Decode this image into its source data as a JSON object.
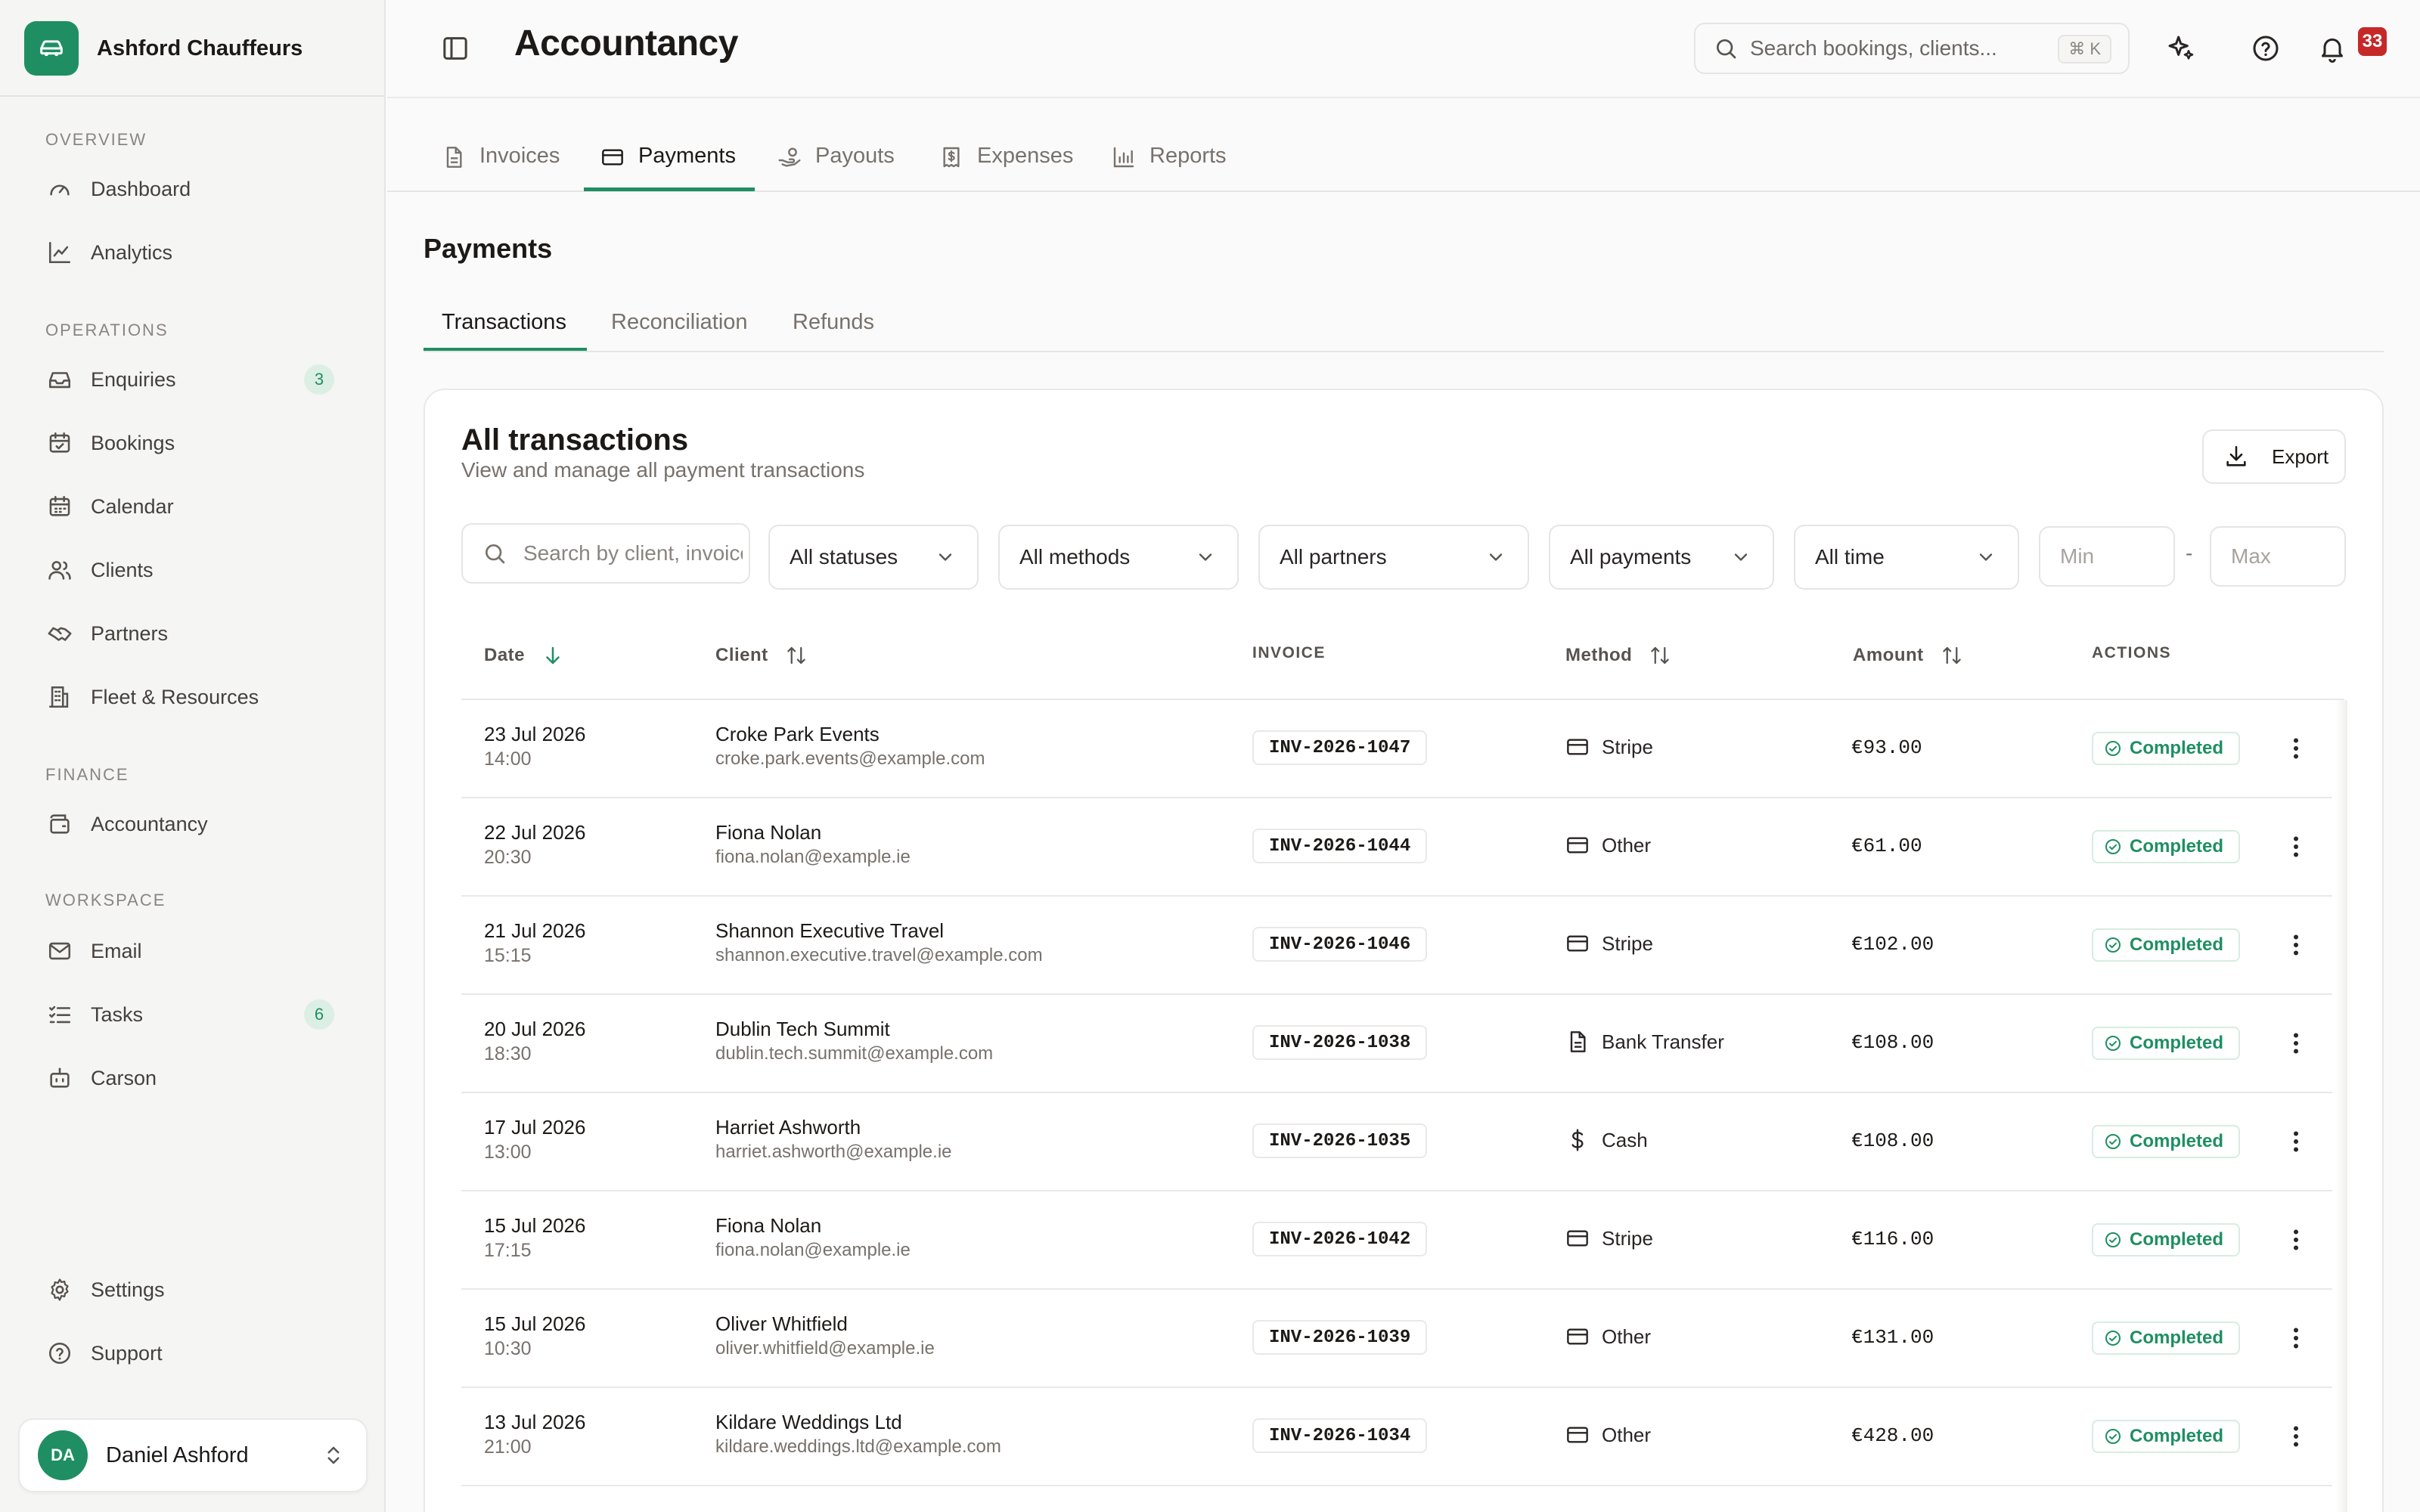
{
  "app": {
    "name": "Ashford Chauffeurs"
  },
  "sidebar": {
    "sections": [
      {
        "title": "OVERVIEW"
      },
      {
        "title": "OPERATIONS"
      },
      {
        "title": "FINANCE"
      },
      {
        "title": "WORKSPACE"
      }
    ],
    "items": [
      {
        "label": "Dashboard",
        "icon": "gauge-icon"
      },
      {
        "label": "Analytics",
        "icon": "line-chart-icon"
      },
      {
        "label": "Enquiries",
        "icon": "inbox-icon",
        "badge": "3"
      },
      {
        "label": "Bookings",
        "icon": "calendar-check-icon"
      },
      {
        "label": "Calendar",
        "icon": "calendar-icon"
      },
      {
        "label": "Clients",
        "icon": "users-icon"
      },
      {
        "label": "Partners",
        "icon": "handshake-icon"
      },
      {
        "label": "Fleet & Resources",
        "icon": "building-icon"
      },
      {
        "label": "Accountancy",
        "icon": "wallet-icon"
      },
      {
        "label": "Email",
        "icon": "mail-icon"
      },
      {
        "label": "Tasks",
        "icon": "list-checks-icon",
        "badge": "6"
      },
      {
        "label": "Carson",
        "icon": "bot-icon"
      },
      {
        "label": "Settings",
        "icon": "gear-icon"
      },
      {
        "label": "Support",
        "icon": "help-circle-icon"
      }
    ]
  },
  "user": {
    "initials": "DA",
    "name": "Daniel Ashford"
  },
  "header": {
    "title": "Accountancy",
    "search_placeholder": "Search bookings, clients...",
    "search_shortcut": "⌘ K",
    "notifications_count": "33"
  },
  "tabs": [
    {
      "label": "Invoices",
      "icon": "file-text-icon"
    },
    {
      "label": "Payments",
      "icon": "credit-card-icon",
      "active": true
    },
    {
      "label": "Payouts",
      "icon": "hand-coins-icon"
    },
    {
      "label": "Expenses",
      "icon": "receipt-icon"
    },
    {
      "label": "Reports",
      "icon": "bar-chart-icon"
    }
  ],
  "section": {
    "title": "Payments"
  },
  "subtabs": [
    {
      "label": "Transactions",
      "active": true
    },
    {
      "label": "Reconciliation"
    },
    {
      "label": "Refunds"
    }
  ],
  "card": {
    "title": "All transactions",
    "subtitle": "View and manage all payment transactions",
    "export_label": "Export"
  },
  "filters": {
    "search_placeholder": "Search by client, invoice...",
    "status": "All statuses",
    "method": "All methods",
    "partner": "All partners",
    "payment": "All payments",
    "time": "All time",
    "min_placeholder": "Min",
    "max_placeholder": "Max",
    "range_separator": "-"
  },
  "table": {
    "columns": {
      "date": "Date",
      "client": "Client",
      "invoice": "INVOICE",
      "method": "Method",
      "amount": "Amount",
      "actions": "ACTIONS"
    },
    "rows": [
      {
        "date": "23 Jul 2026",
        "time": "14:00",
        "client": "Croke Park Events",
        "email": "croke.park.events@example.com",
        "invoice": "INV-2026-1047",
        "method": "Stripe",
        "method_icon": "credit-card-icon",
        "amount": "€93.00",
        "status": "Completed"
      },
      {
        "date": "22 Jul 2026",
        "time": "20:30",
        "client": "Fiona Nolan",
        "email": "fiona.nolan@example.ie",
        "invoice": "INV-2026-1044",
        "method": "Other",
        "method_icon": "credit-card-icon",
        "amount": "€61.00",
        "status": "Completed"
      },
      {
        "date": "21 Jul 2026",
        "time": "15:15",
        "client": "Shannon Executive Travel",
        "email": "shannon.executive.travel@example.com",
        "invoice": "INV-2026-1046",
        "method": "Stripe",
        "method_icon": "credit-card-icon",
        "amount": "€102.00",
        "status": "Completed"
      },
      {
        "date": "20 Jul 2026",
        "time": "18:30",
        "client": "Dublin Tech Summit",
        "email": "dublin.tech.summit@example.com",
        "invoice": "INV-2026-1038",
        "method": "Bank Transfer",
        "method_icon": "file-text-icon",
        "amount": "€108.00",
        "status": "Completed"
      },
      {
        "date": "17 Jul 2026",
        "time": "13:00",
        "client": "Harriet Ashworth",
        "email": "harriet.ashworth@example.ie",
        "invoice": "INV-2026-1035",
        "method": "Cash",
        "method_icon": "dollar-icon",
        "amount": "€108.00",
        "status": "Completed"
      },
      {
        "date": "15 Jul 2026",
        "time": "17:15",
        "client": "Fiona Nolan",
        "email": "fiona.nolan@example.ie",
        "invoice": "INV-2026-1042",
        "method": "Stripe",
        "method_icon": "credit-card-icon",
        "amount": "€116.00",
        "status": "Completed"
      },
      {
        "date": "15 Jul 2026",
        "time": "10:30",
        "client": "Oliver Whitfield",
        "email": "oliver.whitfield@example.ie",
        "invoice": "INV-2026-1039",
        "method": "Other",
        "method_icon": "credit-card-icon",
        "amount": "€131.00",
        "status": "Completed"
      },
      {
        "date": "13 Jul 2026",
        "time": "21:00",
        "client": "Kildare Weddings Ltd",
        "email": "kildare.weddings.ltd@example.com",
        "invoice": "INV-2026-1034",
        "method": "Other",
        "method_icon": "credit-card-icon",
        "amount": "€428.00",
        "status": "Completed"
      }
    ]
  },
  "colors": {
    "accent": "#1f8f63",
    "badge_bg": "#dcefe5",
    "notification": "#c62828"
  }
}
